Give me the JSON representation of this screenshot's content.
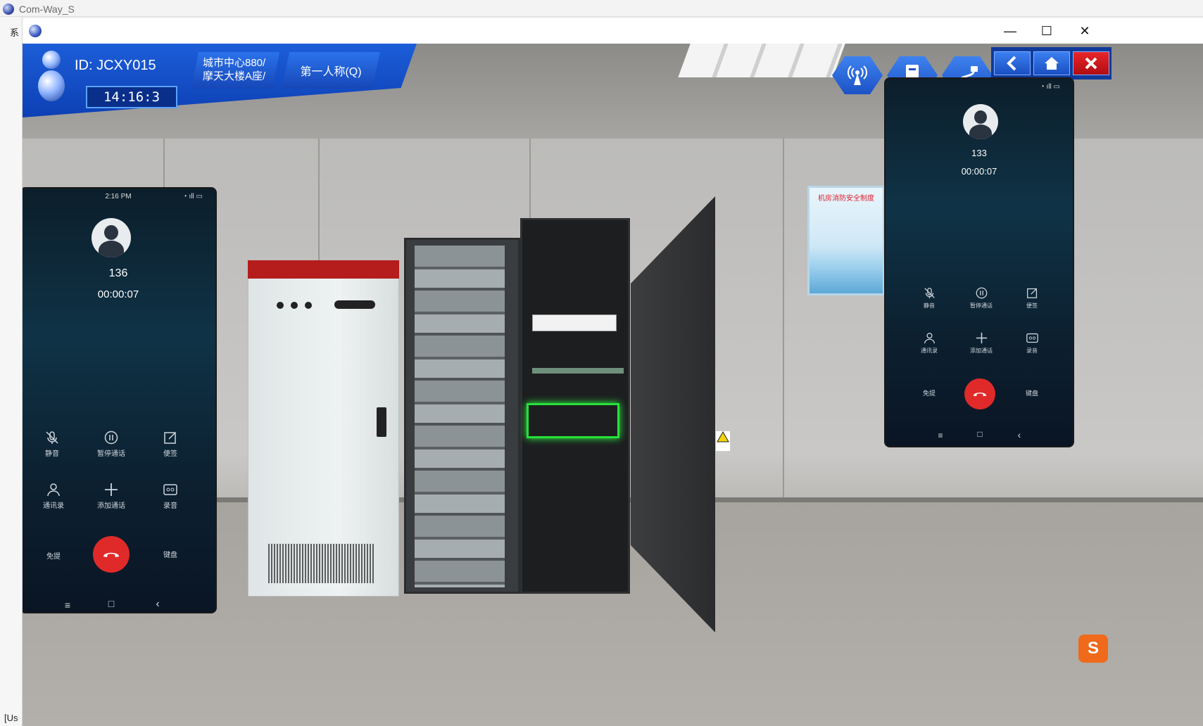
{
  "app": {
    "title": "Com-Way_S",
    "menu_partial": "系",
    "status_partial": "[Us"
  },
  "window": {
    "minimize_glyph": "—",
    "maximize_glyph": "☐",
    "close_glyph": "✕"
  },
  "hud": {
    "user_id": "ID: JCXY015",
    "clock": "14:16:3",
    "location": "城市中心880/\n摩天大楼A座/",
    "location_line1": "城市中心880/",
    "location_line2": "摩天大楼A座/",
    "view_mode": "第一人称(Q)",
    "icons": [
      "signal-tower-icon",
      "device-icon",
      "cable-icon"
    ],
    "nav": [
      "back-icon",
      "home-icon",
      "close-icon"
    ],
    "accent": "#1c5ed8",
    "close_color": "#e8262a"
  },
  "phone_left": {
    "status_time": "2:16 PM",
    "number": "136",
    "duration": "00:00:07",
    "buttons": [
      {
        "label": "静音",
        "icon": "mute-icon"
      },
      {
        "label": "暂停通话",
        "icon": "pause-icon"
      },
      {
        "label": "便签",
        "icon": "note-icon"
      },
      {
        "label": "通讯录",
        "icon": "contacts-icon"
      },
      {
        "label": "添加通话",
        "icon": "add-call-icon"
      },
      {
        "label": "录音",
        "icon": "record-icon"
      }
    ],
    "speaker_label": "免提",
    "keypad_label": "键盘",
    "nav": [
      "≡",
      "□",
      "‹"
    ]
  },
  "phone_right": {
    "status_time": "",
    "number": "133",
    "duration": "00:00:07",
    "buttons": [
      {
        "label": "静音",
        "icon": "mute-icon"
      },
      {
        "label": "暂停通话",
        "icon": "pause-icon"
      },
      {
        "label": "便签",
        "icon": "note-icon"
      },
      {
        "label": "通讯录",
        "icon": "contacts-icon"
      },
      {
        "label": "添加通话",
        "icon": "add-call-icon"
      },
      {
        "label": "录音",
        "icon": "record-icon"
      }
    ],
    "speaker_label": "免提",
    "keypad_label": "键盘",
    "nav": [
      "≡",
      "□",
      "‹"
    ]
  },
  "scene": {
    "poster_title": "机房消防安全制度",
    "end_call_color": "#e02a2a"
  }
}
